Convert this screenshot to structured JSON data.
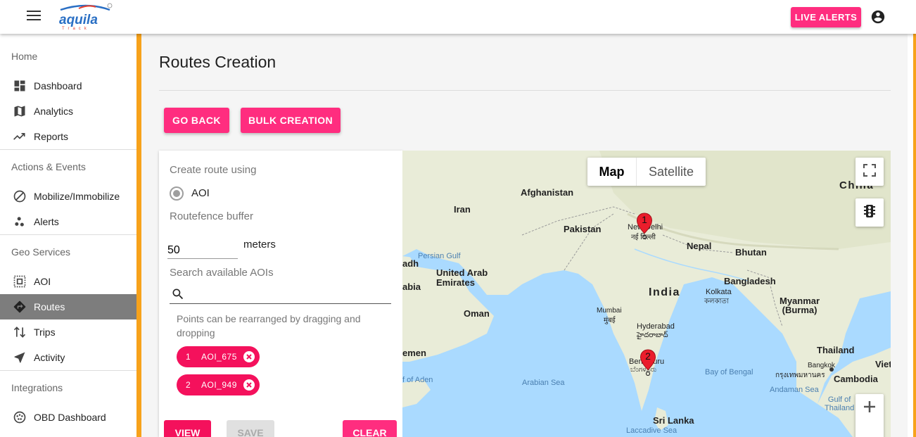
{
  "header": {
    "logo_text": "aquila",
    "logo_sub": "Track",
    "live_alerts_label": "LIVE ALERTS"
  },
  "sidebar": {
    "sections": [
      {
        "title": "Home",
        "items": [
          {
            "label": "Dashboard",
            "icon": "dashboard-icon"
          },
          {
            "label": "Analytics",
            "icon": "map-icon"
          },
          {
            "label": "Reports",
            "icon": "trending-icon"
          }
        ]
      },
      {
        "title": "Actions & Events",
        "items": [
          {
            "label": "Mobilize/Immobilize",
            "icon": "block-icon"
          },
          {
            "label": "Alerts",
            "icon": "bubble-icon"
          }
        ]
      },
      {
        "title": "Geo Services",
        "items": [
          {
            "label": "AOI",
            "icon": "select-area-icon"
          },
          {
            "label": "Routes",
            "icon": "directions-icon",
            "active": true
          },
          {
            "label": "Trips",
            "icon": "swap-icon"
          },
          {
            "label": "Activity",
            "icon": "navigation-icon"
          }
        ]
      },
      {
        "title": "Integrations",
        "items": [
          {
            "label": "OBD Dashboard",
            "icon": "obd-icon"
          }
        ]
      }
    ]
  },
  "main": {
    "title": "Routes Creation",
    "go_back_label": "GO BACK",
    "bulk_creation_label": "BULK CREATION"
  },
  "form": {
    "create_route_label": "Create route using",
    "radio_option": "AOI",
    "buffer_label": "Routefence buffer",
    "buffer_value": "50",
    "buffer_unit": "meters",
    "search_label": "Search available AOIs",
    "search_placeholder": "",
    "hint": "Points can be rearranged by dragging and dropping",
    "points": [
      {
        "num": "1",
        "name": "AOI_675"
      },
      {
        "num": "2",
        "name": "AOI_949"
      }
    ],
    "view_label": "VIEW",
    "save_label": "SAVE",
    "clear_label": "CLEAR"
  },
  "map": {
    "type_map": "Map",
    "type_satellite": "Satellite",
    "labels": {
      "afghanistan": "Afghanistan",
      "iran": "Iran",
      "pakistan": "Pakistan",
      "china": "China",
      "new_delhi": "New Delhi",
      "new_delhi_local": "नई दिल्ली",
      "nepal": "Nepal",
      "bhutan": "Bhutan",
      "persian_gulf": "Persian Gulf",
      "riyadh_part": "adh",
      "arabia_part": "abia",
      "uae": "United Arab\nEmirates",
      "bangladesh": "Bangladesh",
      "india": "India",
      "kolkata": "Kolkata",
      "kolkata_local": "কলকাতা",
      "oman": "Oman",
      "mumbai": "Mumbai",
      "mumbai_local": "मुंबई",
      "myanmar": "Myanmar\n(Burma)",
      "hyderabad": "Hyderabad",
      "hyderabad_local": "హైదరాబాద్",
      "yemen_part": "emen",
      "thailand": "Thailand",
      "viet_part": "Viet",
      "bangkok": "Bangkok",
      "bangkok_local": "กรุงเทพมหานคร",
      "gulf_aden": "f of Aden",
      "arabian_sea": "Arabian Sea",
      "bengaluru": "Bengaluru",
      "bengaluru_local": "ಬೆಂಗಳೂರು",
      "bay_bengal": "Bay of Bengal",
      "cambodia": "Cambodia",
      "andaman_sea": "Andaman Sea",
      "gulf_thailand": "Gulf of\nThailand",
      "sri_lanka": "Sri Lanka",
      "laccadive_sea": "Laccadive Sea"
    },
    "markers": [
      {
        "num": "1",
        "place": "New Delhi"
      },
      {
        "num": "2",
        "place": "Bengaluru"
      }
    ],
    "colors": {
      "water": "#aadaff",
      "land": "#e9ecd8",
      "marker": "#ea1d2c"
    }
  }
}
